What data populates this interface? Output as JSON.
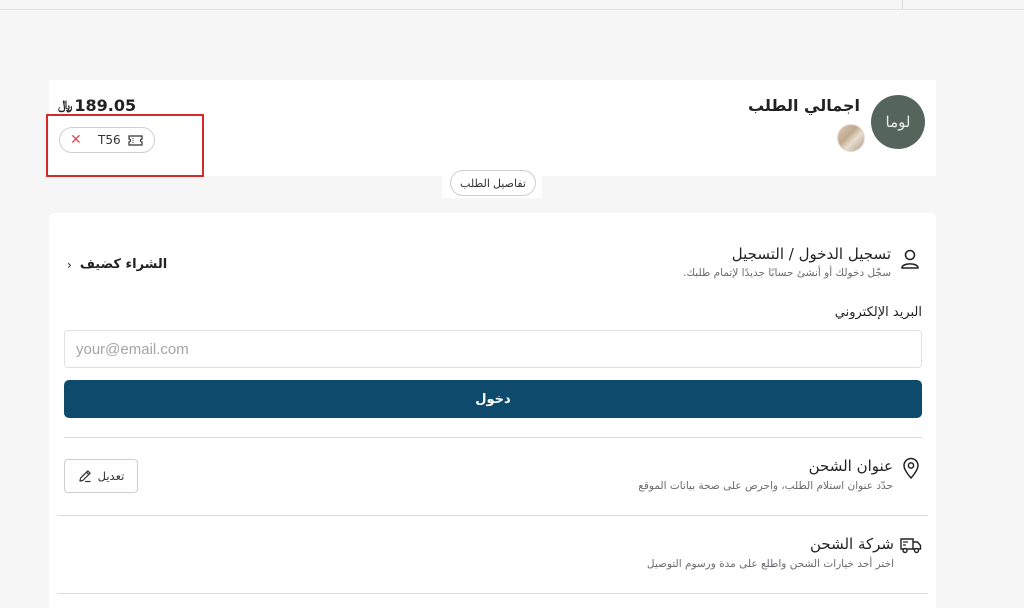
{
  "summary": {
    "title": "اجمالي الطلب",
    "logo_text": "لوما",
    "total": "189.05",
    "currency_symbol": "﷼",
    "coupon_code": "T56",
    "remove_symbol": "✕",
    "details_label": "تفاصيل الطلب"
  },
  "login": {
    "title": "تسجيل الدخول / التسجيل",
    "subtitle": "سجّل دخولك أو أنشئ حسابًا جديدًا لإتمام طلبك.",
    "guest_label": "الشراء كضيف",
    "guest_chevron": "›",
    "email_label": "البريد الإلكتروني",
    "email_placeholder": "your@email.com",
    "email_value": "",
    "submit_label": "دخول"
  },
  "shipping_address": {
    "title": "عنوان الشحن",
    "subtitle": "حدّد عنوان استلام الطلب، واحرص على صحة بيانات الموقع",
    "edit_label": "تعديل"
  },
  "shipping_company": {
    "title": "شركة الشحن",
    "subtitle": "اختر أحد خيارات الشحن واطلع على مدة ورسوم التوصيل"
  },
  "icons": {
    "user": "user-icon",
    "location": "location-pin-icon",
    "truck": "truck-icon",
    "ticket": "ticket-icon",
    "pencil": "pencil-icon",
    "close": "close-icon"
  },
  "colors": {
    "primary_button": "#0d4a6b",
    "remove": "#e14c56",
    "highlight": "#d62a2a",
    "logo_bg": "#55655c"
  }
}
